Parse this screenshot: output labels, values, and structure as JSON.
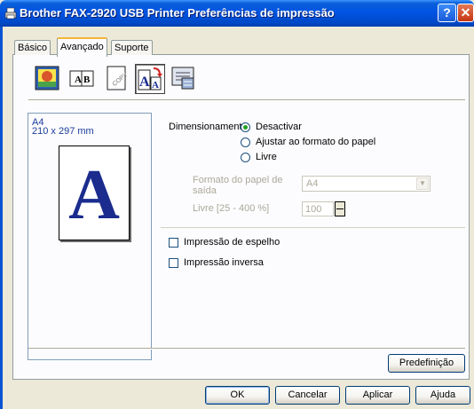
{
  "window": {
    "title": "Brother FAX-2920 USB Printer Preferências de impressão"
  },
  "titlebar_buttons": {
    "help": "?",
    "close": "✕"
  },
  "tabs": [
    {
      "label": "Básico"
    },
    {
      "label": "Avançado",
      "active": true
    },
    {
      "label": "Suporte"
    }
  ],
  "toolbar_icons": [
    {
      "icon": "print-quality-icon"
    },
    {
      "icon": "duplex-icon",
      "text": "A|B"
    },
    {
      "icon": "watermark-icon",
      "text": "COPY"
    },
    {
      "icon": "scaling-icon",
      "selected": true
    },
    {
      "icon": "device-options-icon"
    }
  ],
  "preview": {
    "paper_name": "A4",
    "paper_dims": "210 x 297 mm",
    "letter": "A"
  },
  "scaling": {
    "label": "Dimensionamento",
    "options": [
      {
        "label": "Desactivar",
        "checked": true
      },
      {
        "label": "Ajustar ao formato do papel",
        "checked": false
      },
      {
        "label": "Livre",
        "checked": false
      }
    ],
    "formato_label_line1": "Formato do papel de",
    "formato_label_line2": "saída",
    "formato_value": "A4",
    "livre_range_label": "Livre [25 - 400 %]",
    "livre_value": "100"
  },
  "checks": {
    "espelho": {
      "label": "Impressão de espelho",
      "checked": false
    },
    "inversa": {
      "label": "Impressão inversa",
      "checked": false
    }
  },
  "buttons": {
    "predefinicao": "Predefinição",
    "ok": "OK",
    "cancelar": "Cancelar",
    "aplicar": "Aplicar",
    "ajuda": "Ajuda"
  },
  "colors": {
    "titlebar": "#0054e3",
    "dialog_bg": "#ece9d8",
    "preview_text": "#1b3d9c",
    "letter": "#1b2c8e"
  }
}
